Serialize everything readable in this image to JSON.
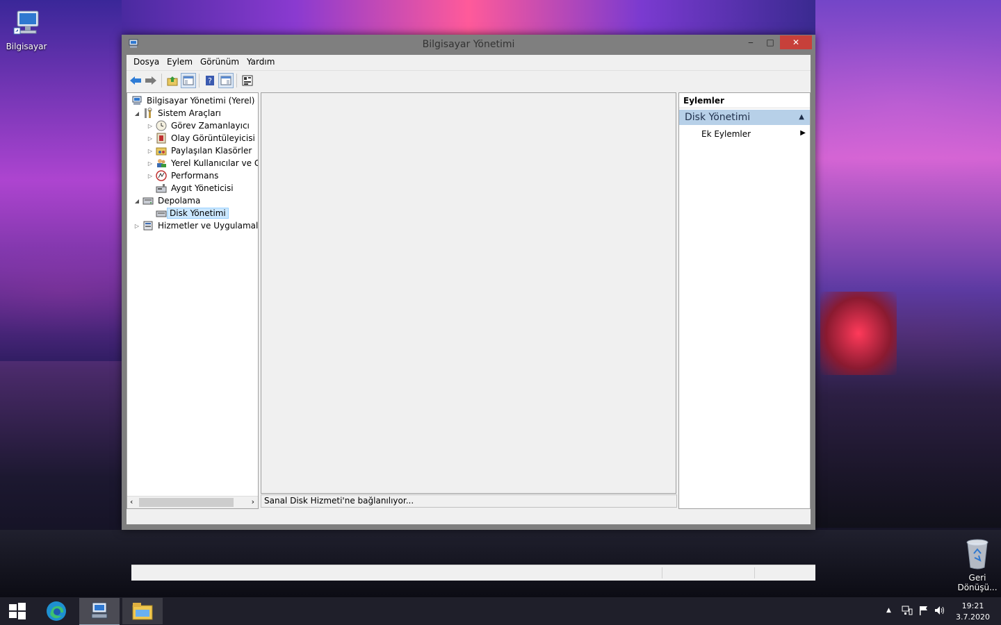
{
  "desktop": {
    "icons": [
      {
        "label": "Bilgisayar",
        "icon": "computer-icon"
      },
      {
        "label": "Geri Dönüşü...",
        "icon": "recycle-bin-icon"
      }
    ]
  },
  "window": {
    "title": "Bilgisayar Yönetimi",
    "controls": {
      "minimize": "‒",
      "maximize": "□",
      "close": "✕"
    },
    "menu": [
      "Dosya",
      "Eylem",
      "Görünüm",
      "Yardım"
    ],
    "toolbar_icons": [
      "back-arrow-icon",
      "forward-arrow-icon",
      "up-folder-icon",
      "show-hide-console-tree-icon",
      "help-icon",
      "show-hide-action-pane-icon",
      "properties-icon"
    ],
    "tree": {
      "root": "Bilgisayar Yönetimi (Yerel)",
      "items": [
        {
          "label": "Sistem Araçları",
          "level": 1,
          "expander": "◢",
          "icon": "tools-icon"
        },
        {
          "label": "Görev Zamanlayıcı",
          "level": 2,
          "expander": "▷",
          "icon": "clock-icon"
        },
        {
          "label": "Olay Görüntüleyicisi",
          "level": 2,
          "expander": "▷",
          "icon": "event-viewer-icon"
        },
        {
          "label": "Paylaşılan Klasörler",
          "level": 2,
          "expander": "▷",
          "icon": "shared-folder-icon"
        },
        {
          "label": "Yerel Kullanıcılar ve Gru",
          "level": 2,
          "expander": "▷",
          "icon": "users-icon"
        },
        {
          "label": "Performans",
          "level": 2,
          "expander": "▷",
          "icon": "performance-icon"
        },
        {
          "label": "Aygıt Yöneticisi",
          "level": 2,
          "expander": "",
          "icon": "device-manager-icon"
        },
        {
          "label": "Depolama",
          "level": 1,
          "expander": "◢",
          "icon": "storage-icon"
        },
        {
          "label": "Disk Yönetimi",
          "level": 2,
          "expander": "",
          "icon": "disk-icon",
          "selected": true
        },
        {
          "label": "Hizmetler ve Uygulamalar",
          "level": 1,
          "expander": "▷",
          "icon": "services-icon"
        }
      ]
    },
    "status_message": "Sanal Disk Hizmeti'ne bağlanılıyor...",
    "actions": {
      "header": "Eylemler",
      "section": "Disk Yönetimi",
      "item": "Ek Eylemler"
    }
  },
  "taskbar": {
    "apps": [
      "start-icon",
      "edge-icon",
      "computer-management-icon",
      "file-explorer-icon"
    ],
    "clock_time": "19:21",
    "clock_date": "3.7.2020"
  },
  "colors": {
    "accent_selection": "#cce8ff",
    "actions_section": "#b7d0e8",
    "close_button": "#c7403a",
    "taskbar": "#1f1f2a"
  }
}
